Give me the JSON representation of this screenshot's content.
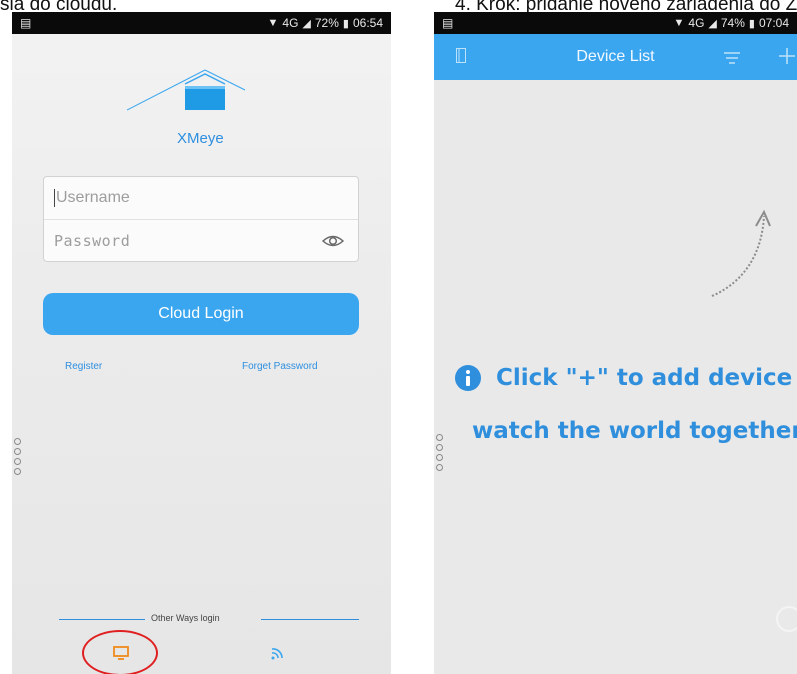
{
  "captions": {
    "left": "sia do cloudu.",
    "right": "4. Krok: pridanie nového zariadenia do Z"
  },
  "colors": {
    "accent": "#3aa6ef",
    "link": "#2e8fe0",
    "annotation": "#e02020"
  },
  "login_screen": {
    "status_bar": {
      "left_icon": "sim-card-icon",
      "signal": "4G",
      "battery": "72%",
      "time": "06:54"
    },
    "brand": "XMeye",
    "logo_icon": "house-roof-icon",
    "username_placeholder": "Username",
    "password_placeholder": "Password",
    "eye_icon": "eye-icon",
    "cloud_login_label": "Cloud Login",
    "register_label": "Register",
    "forget_password_label": "Forget Password",
    "other_ways_label": "Other Ways login",
    "bottom_icons": [
      "monitor-icon",
      "wifi-icon"
    ]
  },
  "device_screen": {
    "status_bar": {
      "left_icon": "sim-card-icon",
      "signal": "4G",
      "battery": "74%",
      "time": "07:04"
    },
    "title": "Device List",
    "appbar_icons": [
      "menu-icon",
      "filter-icon",
      "plus-icon"
    ],
    "message_line1": "Click \"+\" to add device",
    "message_line2": "watch the world together",
    "info_icon": "info-icon"
  }
}
